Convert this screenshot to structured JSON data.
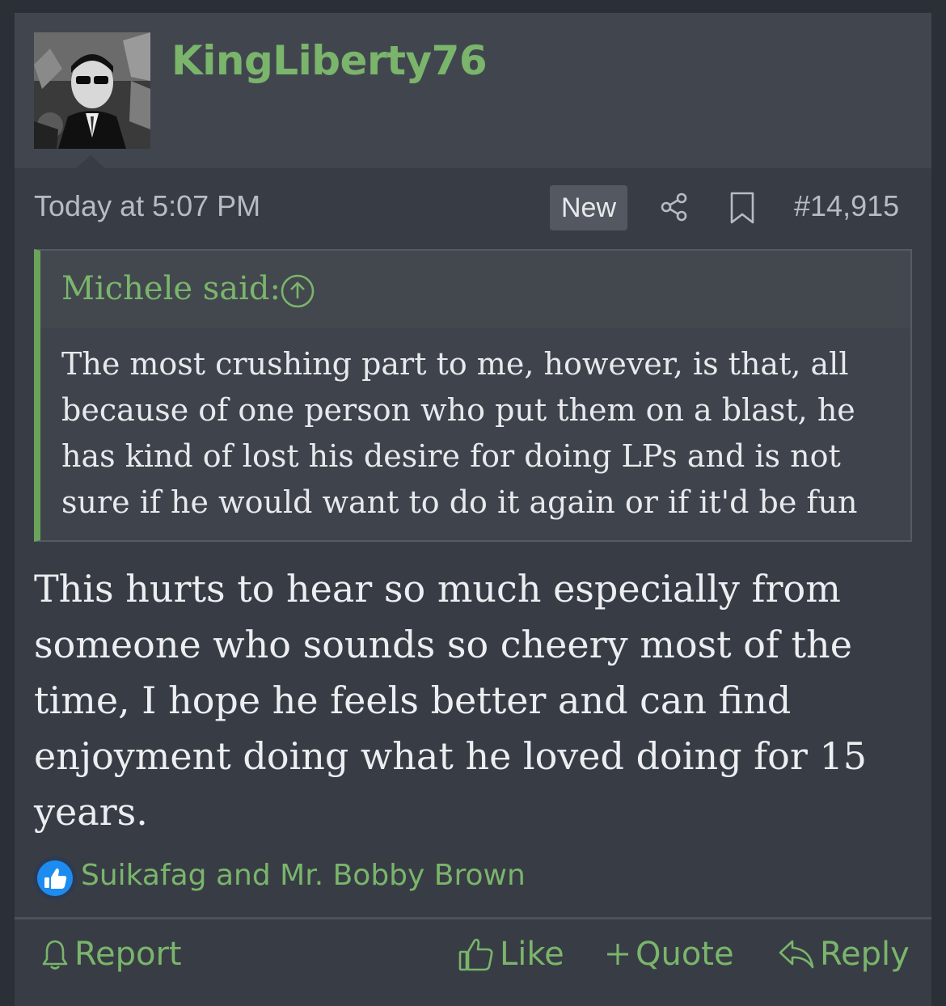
{
  "post": {
    "username": "KingLiberty76",
    "timestamp": "Today at 5:07 PM",
    "new_badge": "New",
    "post_number": "#14,915",
    "share_icon": "share-icon",
    "bookmark_icon": "bookmark-icon"
  },
  "quote": {
    "author_label": "Michele said:",
    "jump_icon": "arrow-up-circle-icon",
    "text": "The most crushing part to me, however, is that, all because of one person who put them on a blast, he has kind of lost his desire for doing LPs and is not sure if he would want to do it again or if it'd be fun"
  },
  "body": {
    "text": "This hurts to hear so much especially from someone who sounds so cheery most of the time, I hope he feels better and can find enjoyment doing what he loved doing for 15 years."
  },
  "reactions": {
    "icon": "thumbs-up-icon",
    "names": "Suikafag and Mr. Bobby Brown"
  },
  "actions": {
    "report": "Report",
    "like": "Like",
    "quote": "Quote",
    "reply": "Reply"
  },
  "colors": {
    "accent": "#7ab56b",
    "quote_border": "#6aa35a",
    "background": "#383d45"
  }
}
